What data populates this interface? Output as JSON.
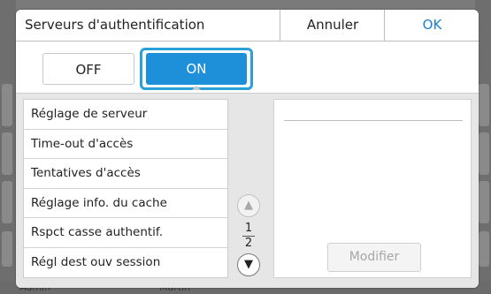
{
  "dialog": {
    "title": "Serveurs d'authentification",
    "cancel_label": "Annuler",
    "ok_label": "OK"
  },
  "toggle": {
    "off_label": "OFF",
    "on_label": "ON",
    "selected": "ON"
  },
  "menu": {
    "items": [
      {
        "label": "Réglage de serveur"
      },
      {
        "label": "Time-out d'accès"
      },
      {
        "label": "Tentatives d'accès"
      },
      {
        "label": "Réglage info. du cache"
      },
      {
        "label": "Rspct casse authentif."
      },
      {
        "label": "Régl dest ouv session"
      }
    ]
  },
  "pager": {
    "current": "1",
    "total": "2"
  },
  "detail": {
    "modify_label": "Modifier"
  },
  "background": {
    "left_text": "Admin",
    "center_text": "Martin"
  },
  "colors": {
    "accent": "#1e8fd9",
    "ok_text": "#1a7fd4",
    "focus_ring": "#2a9fd8"
  },
  "icons": {
    "scroll_up": "chevron-up-icon",
    "scroll_down": "chevron-down-icon"
  }
}
